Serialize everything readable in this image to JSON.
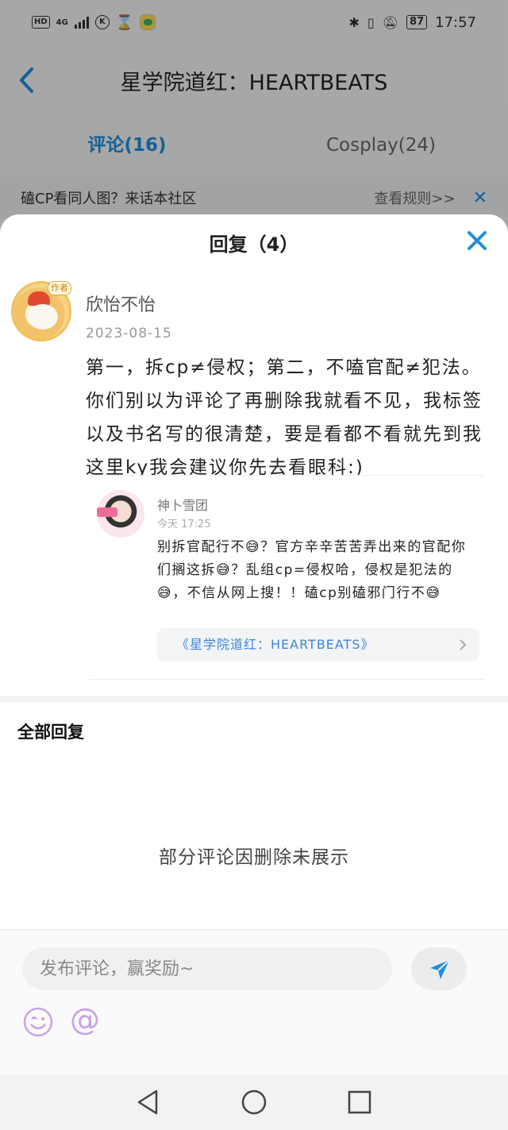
{
  "status_bar": {
    "hd": "HD",
    "network": "4G",
    "k_icon": "K",
    "battery": "87",
    "time": "17:57"
  },
  "nav": {
    "title": "星学院道红：HEARTBEATS"
  },
  "tabs": [
    {
      "label": "评论(16)",
      "active": true
    },
    {
      "label": "Cosplay(24)",
      "active": false
    }
  ],
  "notice": {
    "text": "磕CP看同人图？来话本社区",
    "rule": "查看规则>>",
    "close": "✕"
  },
  "sheet": {
    "title": "回复（4）",
    "close": "✕"
  },
  "comment": {
    "user": "欣怡不怡",
    "author_tag": "作者",
    "date": "2023-08-15",
    "body": "第一，拆cp≠侵权；第二，不嗑官配≠犯法。你们别以为评论了再删除我就看不见，我标签以及书名写的很清楚，要是看都不看就先到我这里ky我会建议你先去看眼科:)"
  },
  "quoted": {
    "user": "神卜雪团",
    "time": "今天 17:25",
    "body": "别拆官配行不😅？官方辛辛苦苦弄出来的官配你们搁这拆😅？乱组cp=侵权哈，侵权是犯法的😅，不信从网上搜！！磕cp别磕邪门行不😅",
    "book_link": "《星学院道红：HEARTBEATS》"
  },
  "all_replies": {
    "title": "全部回复",
    "empty_note": "部分评论因删除未展示"
  },
  "input": {
    "placeholder": "发布评论，赢奖励~",
    "at_symbol": "@"
  },
  "colors": {
    "accent": "#1e8fdd",
    "link": "#3a86e0",
    "emoji_icon": "#c8a3e8"
  }
}
